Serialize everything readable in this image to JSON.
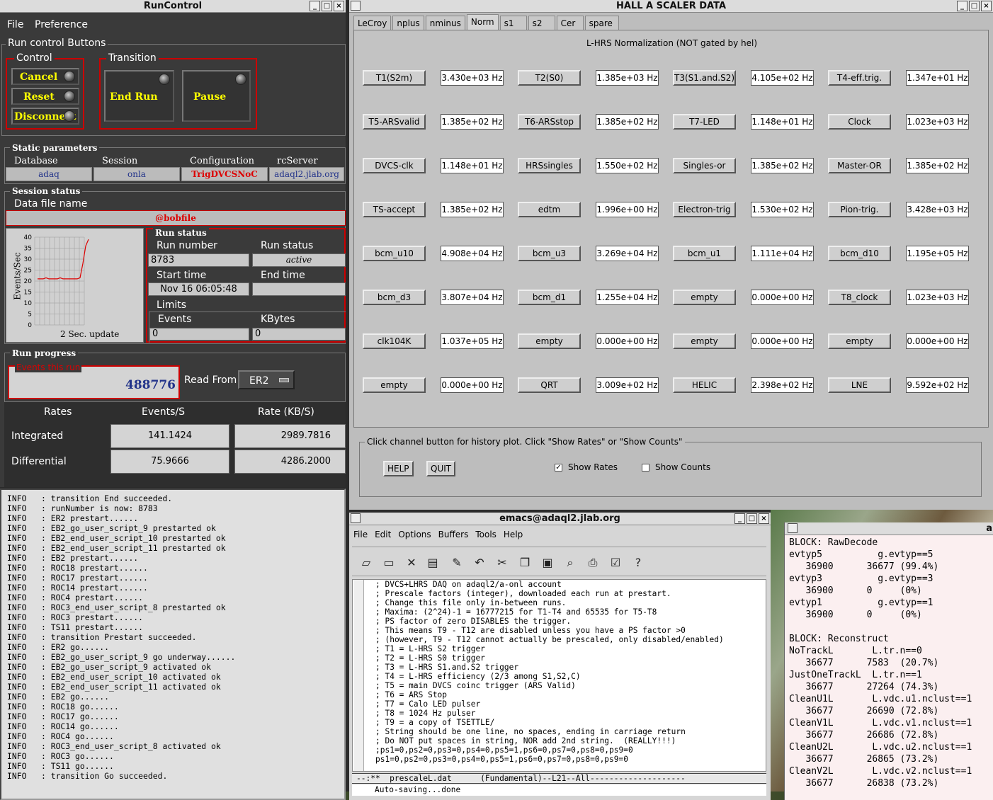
{
  "runcontrol": {
    "title": "RunControl",
    "menu": [
      "File",
      "Preference"
    ],
    "section_buttons": "Run control Buttons",
    "control_label": "Control",
    "transition_label": "Transition",
    "control_buttons": [
      "Cancel",
      "Reset",
      "Disconnect"
    ],
    "transition_buttons": [
      "End Run",
      "Pause"
    ],
    "static_params_label": "Static parameters",
    "static_headers": [
      "Database",
      "Session",
      "Configuration",
      "rcServer"
    ],
    "static_values": [
      "adaq",
      "onla",
      "TrigDVCSNoC",
      "adaql2.jlab.org"
    ],
    "session_status_label": "Session status",
    "data_file_label": "Data file name",
    "data_file_value": "@bobfile",
    "graph": {
      "ylabel": "Events/Sec",
      "yticks": [
        "40",
        "35",
        "30",
        "25",
        "20",
        "15",
        "10",
        "5",
        "0"
      ],
      "footer": "2 Sec. update",
      "points": [
        21,
        21,
        21,
        21.5,
        21,
        21,
        21,
        21,
        21.5,
        21,
        21,
        21,
        21,
        21,
        21,
        21.5,
        28,
        36,
        39
      ]
    },
    "run_status_label": "Run status",
    "run_number_label": "Run number",
    "run_number_value": "8783",
    "run_status_sub_label": "Run status",
    "run_status_value": "active",
    "start_time_label": "Start time",
    "start_time_value": "Nov 16 06:05:48",
    "end_time_label": "End time",
    "end_time_value": "",
    "limits_label": "Limits",
    "events_label": "Events",
    "events_value": "0",
    "kbytes_label": "KBytes",
    "kbytes_value": "0",
    "run_progress_label": "Run progress",
    "events_this_run_label": "Events this run",
    "events_this_run_value": "488776",
    "read_from_label": "Read From:",
    "read_from_value": "ER2",
    "rates_headers": [
      "Rates",
      "Events/S",
      "Rate (KB/S)"
    ],
    "rates_rows": [
      {
        "label": "Integrated",
        "events": "141.1424",
        "rate": "2989.7816"
      },
      {
        "label": "Differential",
        "events": "75.9666",
        "rate": "4286.2000"
      }
    ]
  },
  "log": [
    "INFO   : transition End succeeded.",
    "INFO   : runNumber is now: 8783",
    "INFO   : ER2 prestart......",
    "INFO   : EB2_go_user_script_9 prestarted ok",
    "INFO   : EB2_end_user_script_10 prestarted ok",
    "INFO   : EB2_end_user_script_11 prestarted ok",
    "INFO   : EB2 prestart......",
    "INFO   : ROC18 prestart......",
    "INFO   : ROC17 prestart......",
    "INFO   : ROC14 prestart......",
    "INFO   : ROC4 prestart......",
    "INFO   : ROC3_end_user_script_8 prestarted ok",
    "INFO   : ROC3 prestart......",
    "INFO   : TS11 prestart......",
    "INFO   : transition Prestart succeeded.",
    "INFO   : ER2 go......",
    "INFO   : EB2_go_user_script_9 go underway......",
    "INFO   : EB2_go_user_script_9 activated ok",
    "INFO   : EB2_end_user_script_10 activated ok",
    "INFO   : EB2_end_user_script_11 activated ok",
    "INFO   : EB2 go......",
    "INFO   : ROC18 go......",
    "INFO   : ROC17 go......",
    "INFO   : ROC14 go......",
    "INFO   : ROC4 go......",
    "INFO   : ROC3_end_user_script_8 activated ok",
    "INFO   : ROC3 go......",
    "INFO   : TS11 go......",
    "INFO   : transition Go succeeded."
  ],
  "scaler": {
    "title": "HALL  A  SCALER  DATA",
    "tabs": [
      "LeCroy",
      "nplus",
      "nminus",
      "Norm",
      "s1",
      "s2",
      "Cer",
      "spare"
    ],
    "active_tab": "Norm",
    "heading": "L-HRS Normalization (NOT gated by hel)",
    "rows": [
      [
        [
          "T1(S2m)",
          "3.430e+03 Hz"
        ],
        [
          "T2(S0)",
          "1.385e+03 Hz"
        ],
        [
          "T3(S1.and.S2)",
          "4.105e+02 Hz"
        ],
        [
          "T4-eff.trig.",
          "1.347e+01 Hz"
        ]
      ],
      [
        [
          "T5-ARSvalid",
          "1.385e+02 Hz"
        ],
        [
          "T6-ARSstop",
          "1.385e+02 Hz"
        ],
        [
          "T7-LED",
          "1.148e+01 Hz"
        ],
        [
          "Clock",
          "1.023e+03 Hz"
        ]
      ],
      [
        [
          "DVCS-clk",
          "1.148e+01 Hz"
        ],
        [
          "HRSsingles",
          "1.550e+02 Hz"
        ],
        [
          "Singles-or",
          "1.385e+02 Hz"
        ],
        [
          "Master-OR",
          "1.385e+02 Hz"
        ]
      ],
      [
        [
          "TS-accept",
          "1.385e+02 Hz"
        ],
        [
          "edtm",
          "1.996e+00 Hz"
        ],
        [
          "Electron-trig",
          "1.530e+02 Hz"
        ],
        [
          "Pion-trig.",
          "3.428e+03 Hz"
        ]
      ],
      [
        [
          "bcm_u10",
          "4.908e+04 Hz"
        ],
        [
          "bcm_u3",
          "3.269e+04 Hz"
        ],
        [
          "bcm_u1",
          "1.111e+04 Hz"
        ],
        [
          "bcm_d10",
          "1.195e+05 Hz"
        ]
      ],
      [
        [
          "bcm_d3",
          "3.807e+04 Hz"
        ],
        [
          "bcm_d1",
          "1.255e+04 Hz"
        ],
        [
          "empty",
          "0.000e+00 Hz"
        ],
        [
          "T8_clock",
          "1.023e+03 Hz"
        ]
      ],
      [
        [
          "clk104K",
          "1.037e+05 Hz"
        ],
        [
          "empty",
          "0.000e+00 Hz"
        ],
        [
          "empty",
          "0.000e+00 Hz"
        ],
        [
          "empty",
          "0.000e+00 Hz"
        ]
      ],
      [
        [
          "empty",
          "0.000e+00 Hz"
        ],
        [
          "QRT",
          "3.009e+02 Hz"
        ],
        [
          "HELIC",
          "2.398e+02 Hz"
        ],
        [
          "LNE",
          "9.592e+02 Hz"
        ]
      ]
    ],
    "hint": "Click channel button for history plot.  Click \"Show Rates\" or \"Show Counts\"",
    "help_label": "HELP",
    "quit_label": "QUIT",
    "show_rates_label": "Show Rates",
    "show_counts_label": "Show Counts",
    "show_rates_checked": true
  },
  "emacs": {
    "title": "emacs@adaql2.jlab.org",
    "menu": [
      "File",
      "Edit",
      "Options",
      "Buffers",
      "Tools",
      "Help"
    ],
    "lines": [
      "; DVCS+LHRS DAQ on adaql2/a-onl account",
      "; Prescale factors (integer), downloaded each run at prestart.",
      "; Change this file only in-between runs.",
      "; Maxima: (2^24)-1 = 16777215 for T1-T4 and 65535 for T5-T8",
      "; PS factor of zero DISABLES the trigger.",
      "; This means T9 - T12 are disabled unless you have a PS factor >0",
      "; (however, T9 - T12 cannot actually be prescaled, only disabled/enabled)",
      "; T1 = L-HRS S2 trigger",
      "; T2 = L-HRS S0 trigger",
      "; T3 = L-HRS S1.and.S2 trigger",
      "; T4 = L-HRS efficiency (2/3 among S1,S2,C)",
      "; T5 = main DVCS coinc trigger (ARS Valid)",
      "; T6 = ARS Stop",
      "; T7 = Calo LED pulser",
      "; T8 = 1024 Hz pulser",
      "; T9 = a copy of TSETTLE/",
      "; String should be one line, no spaces, ending in carriage return",
      "; Do NOT put spaces in string, NOR add 2nd string.  (REALLY!!!)",
      ";ps1=0,ps2=0,ps3=0,ps4=0,ps5=1,ps6=0,ps7=0,ps8=0,ps9=0",
      "ps1=0,ps2=0,ps3=0,ps4=0,ps5=1,ps6=0,ps7=0,ps8=0,ps9=0",
      ""
    ],
    "modeline": "--:**  prescaleL.dat      (Fundamental)--L21--All--------------------",
    "minibuffer": "Auto-saving...done"
  },
  "analyzer": {
    "title": "a",
    "lines": [
      "BLOCK: RawDecode",
      "evtyp5          g.evtyp==5",
      "   36900      36677 (99.4%)",
      "evtyp3          g.evtyp==3",
      "   36900      0     (0%)",
      "evtyp1          g.evtyp==1",
      "   36900      0     (0%)",
      "",
      "BLOCK: Reconstruct",
      "NoTrackL       L.tr.n==0",
      "   36677      7583  (20.7%)",
      "JustOneTrackL  L.tr.n==1",
      "   36677      27264 (74.3%)",
      "CleanU1L       L.vdc.u1.nclust==1",
      "   36677      26690 (72.8%)",
      "CleanV1L       L.vdc.v1.nclust==1",
      "   36677      26686 (72.8%)",
      "CleanU2L       L.vdc.u2.nclust==1",
      "   36677      26865 (73.2%)",
      "CleanV2L       L.vdc.v2.nclust==1",
      "   36677      26838 (73.2%)"
    ]
  }
}
